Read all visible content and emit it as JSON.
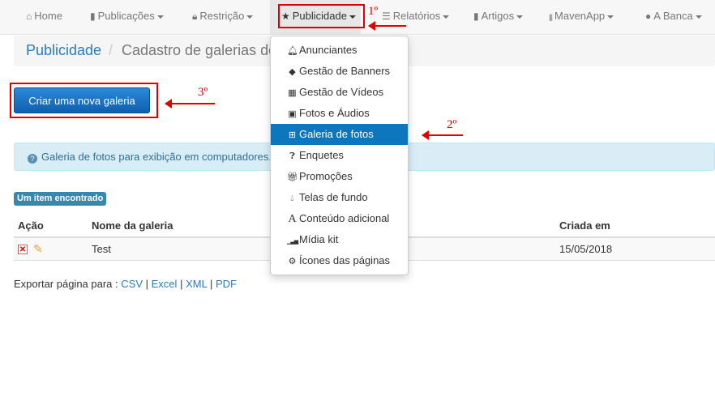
{
  "nav": {
    "items": [
      {
        "label": "Home",
        "icon": "home-icon",
        "glyph": "⌂",
        "caret": false
      },
      {
        "label": "Publicações",
        "icon": "file-icon",
        "glyph": "▮",
        "caret": true
      },
      {
        "label": "Restrição",
        "icon": "lock-icon",
        "glyph": "🔒︎",
        "caret": true
      },
      {
        "label": "Publicidade",
        "icon": "star-icon",
        "glyph": "★",
        "caret": true,
        "open": true
      },
      {
        "label": "Relatórios",
        "icon": "list-icon",
        "glyph": "☰",
        "caret": true
      },
      {
        "label": "Artigos",
        "icon": "bookmark-icon",
        "glyph": "▮",
        "caret": true
      },
      {
        "label": "MavenApp",
        "icon": "barcode-icon",
        "glyph": "|||",
        "caret": true
      },
      {
        "label": "A Banca",
        "icon": "globe-icon",
        "glyph": "●",
        "caret": true
      }
    ]
  },
  "breadcrumb": {
    "home": "Publicidade",
    "separator": "/",
    "current": "Cadastro de galerias de fotos"
  },
  "create_button": {
    "label": "Criar uma nova galeria"
  },
  "annotations": {
    "step1": "1º",
    "step2": "2º",
    "step3": "3º",
    "color": "#e00000"
  },
  "alert": {
    "text": "Galeria de fotos para exibição em computadores."
  },
  "badge": {
    "text": "Um item encontrado"
  },
  "table": {
    "headers": [
      "Ação",
      "Nome da galeria",
      "Criada em"
    ],
    "rows": [
      {
        "name": "Test",
        "created": "15/05/2018"
      }
    ]
  },
  "export": {
    "prefix": "Exportar página para :",
    "formats": [
      "CSV",
      "Excel",
      "XML",
      "PDF"
    ],
    "separator": "|"
  },
  "dropdown": {
    "items": [
      {
        "label": "Anunciantes",
        "icon": "bell-icon",
        "glyph": "🔔︎"
      },
      {
        "label": "Gestão de Banners",
        "icon": "tags-icon",
        "glyph": "◆"
      },
      {
        "label": "Gestão de Vídeos",
        "icon": "film-icon",
        "glyph": "▦"
      },
      {
        "label": "Fotos e Áudios",
        "icon": "picture-icon",
        "glyph": "▣"
      },
      {
        "label": "Galeria de fotos",
        "icon": "th-large-icon",
        "glyph": "⊞",
        "active": true
      },
      {
        "label": "Enquetes",
        "icon": "question-circle-icon",
        "glyph": "❓︎"
      },
      {
        "label": "Promoções",
        "icon": "gift-icon",
        "glyph": "🎁︎"
      },
      {
        "label": "Telas de fundo",
        "icon": "tint-icon",
        "glyph": "💧︎"
      },
      {
        "label": "Conteúdo adicional",
        "icon": "font-icon",
        "glyph": "A"
      },
      {
        "label": "Mídia kit",
        "icon": "signal-icon",
        "glyph": "▁▃▅"
      },
      {
        "label": "Ícones das páginas",
        "icon": "cog-icon",
        "glyph": "⚙"
      }
    ]
  },
  "colors": {
    "accent": "#0e76bc",
    "link": "#2a7bbf",
    "alert_bg": "#d9edf7"
  }
}
